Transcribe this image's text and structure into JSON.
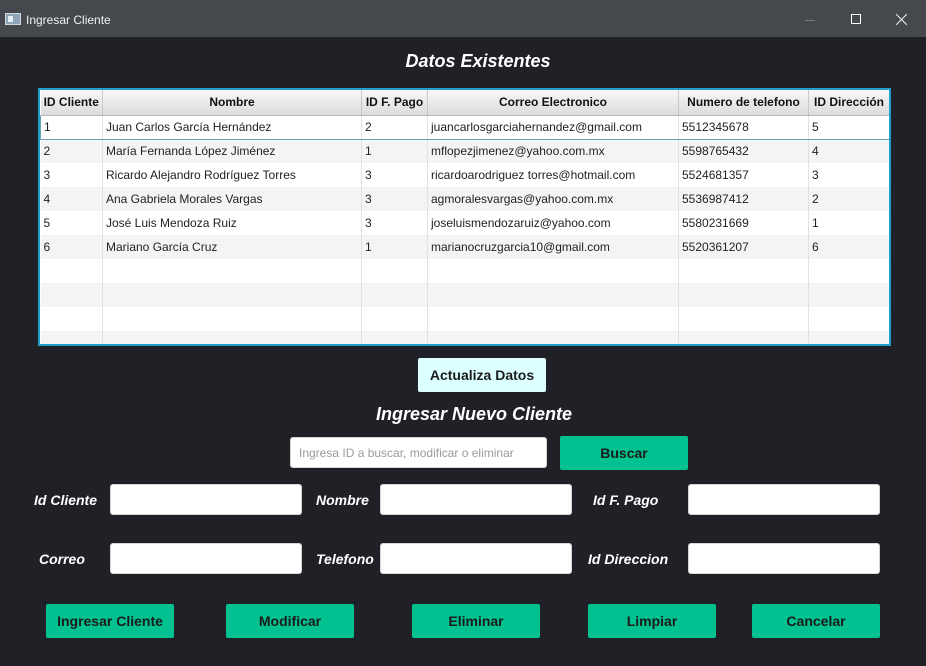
{
  "window": {
    "title": "Ingresar Cliente",
    "controls": {
      "minimize": "—",
      "maximize": "☐",
      "close": "✕"
    }
  },
  "headings": {
    "existing": "Datos Existentes",
    "new_client": "Ingresar Nuevo Cliente"
  },
  "table": {
    "columns": [
      "ID Cliente",
      "Nombre",
      "ID F. Pago",
      "Correo Electronico",
      "Numero de telefono",
      "ID Dirección"
    ],
    "rows": [
      [
        "1",
        "Juan Carlos García Hernández",
        "2",
        "juancarlosgarciahernandez@gmail.com",
        "5512345678",
        "5"
      ],
      [
        "2",
        "María Fernanda López Jiménez",
        "1",
        "mflopezjimenez@yahoo.com.mx",
        "5598765432",
        "4"
      ],
      [
        "3",
        "Ricardo Alejandro Rodríguez Torres",
        "3",
        "ricardoarodriguez torres@hotmail.com",
        "5524681357",
        "3"
      ],
      [
        "4",
        "Ana Gabriela Morales Vargas",
        "3",
        "agmoralesvargas@yahoo.com.mx",
        "5536987412",
        "2"
      ],
      [
        "5",
        "José Luis Mendoza Ruiz",
        "3",
        "joseluismendozaruiz@yahoo.com",
        "5580231669",
        "1"
      ],
      [
        "6",
        "Mariano García Cruz",
        "1",
        "marianocruzgarcia10@gmail.com",
        "5520361207",
        "6"
      ]
    ],
    "selected_row": 0
  },
  "buttons": {
    "actualiza": "Actualiza Datos",
    "buscar": "Buscar",
    "ingresar": "Ingresar Cliente",
    "modificar": "Modificar",
    "eliminar": "Eliminar",
    "limpiar": "Limpiar",
    "cancelar": "Cancelar"
  },
  "search": {
    "placeholder": "Ingresa ID a buscar, modificar o eliminar",
    "value": ""
  },
  "form": {
    "id_cliente": {
      "label": "Id Cliente",
      "value": ""
    },
    "nombre": {
      "label": "Nombre",
      "value": ""
    },
    "id_pago": {
      "label": "Id F. Pago",
      "value": ""
    },
    "correo": {
      "label": "Correo",
      "value": ""
    },
    "telefono": {
      "label": "Telefono",
      "value": ""
    },
    "id_direccion": {
      "label": "Id Direccion",
      "value": ""
    }
  },
  "colors": {
    "background": "#1f2127",
    "titlebar": "#45494e",
    "accent_green": "#00c18f",
    "light_button": "#dcffff",
    "table_border": "#1f9ec9"
  }
}
